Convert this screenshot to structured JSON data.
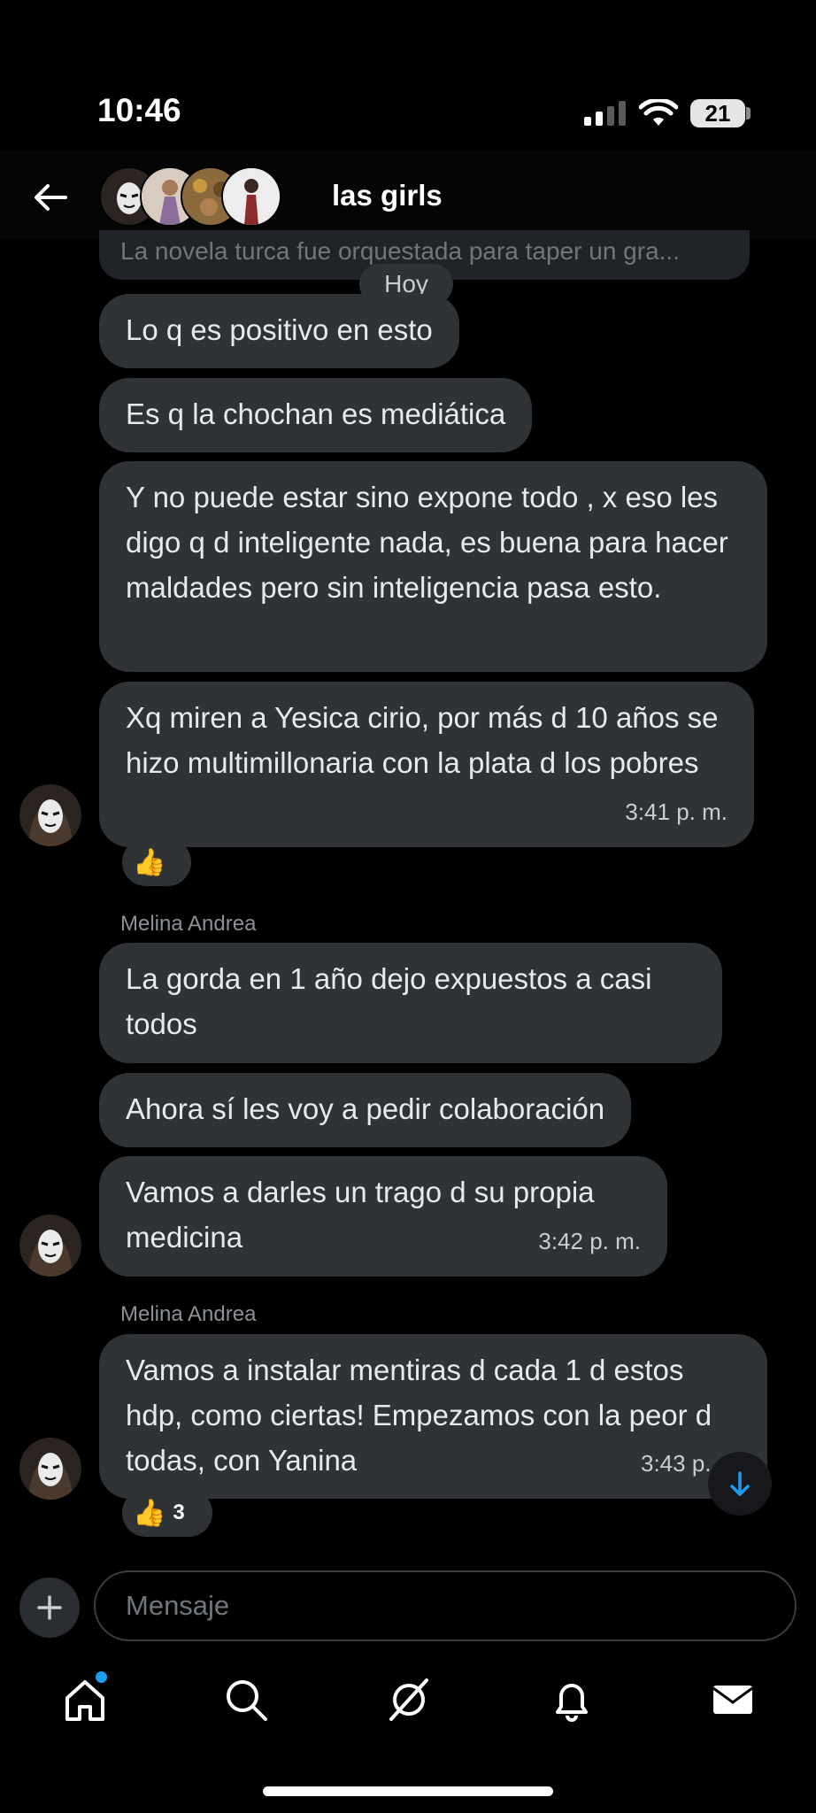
{
  "status": {
    "time": "10:46",
    "battery": "21"
  },
  "header": {
    "title": "las girls"
  },
  "preview": {
    "text": "La novela turca fue orquestada para taper un gra..."
  },
  "day_chip": "Hoy",
  "messages": [
    {
      "text": "Lo q es positivo en esto"
    },
    {
      "text": "Es q la chochan es mediática"
    },
    {
      "text": "Y no puede estar sino expone todo , x eso les digo q d inteligente nada, es buena para hacer maldades pero sin inteligencia pasa esto."
    },
    {
      "text": "Xq miren a Yesica cirio, por más d 10 años se hizo multimillonaria con la plata d los pobres",
      "time": "3:41 p. m.",
      "reaction": "👍"
    },
    {
      "sender": "Melina Andrea",
      "text": "La gorda en 1 año dejo expuestos a casi todos"
    },
    {
      "text": "Ahora sí les voy a pedir colaboración"
    },
    {
      "text": "Vamos a darles un trago d su propia medicina",
      "time": "3:42 p. m."
    },
    {
      "sender": "Melina Andrea",
      "text": "Vamos a instalar mentiras d cada 1 d estos hdp, como ciertas! Empezamos con la peor d todas, con Yanina",
      "time": "3:43 p.",
      "reaction": "👍",
      "reaction_count": "3"
    }
  ],
  "composer": {
    "placeholder": "Mensaje"
  },
  "icons": {
    "back": "arrow-left-icon",
    "plus": "plus-icon",
    "scroll": "arrow-down-icon",
    "tabs": [
      "home-icon",
      "search-icon",
      "grok-icon",
      "bell-icon",
      "mail-icon"
    ]
  },
  "colors": {
    "bubble": "#2f3336",
    "accent": "#1d9bf0",
    "background": "#000000"
  }
}
